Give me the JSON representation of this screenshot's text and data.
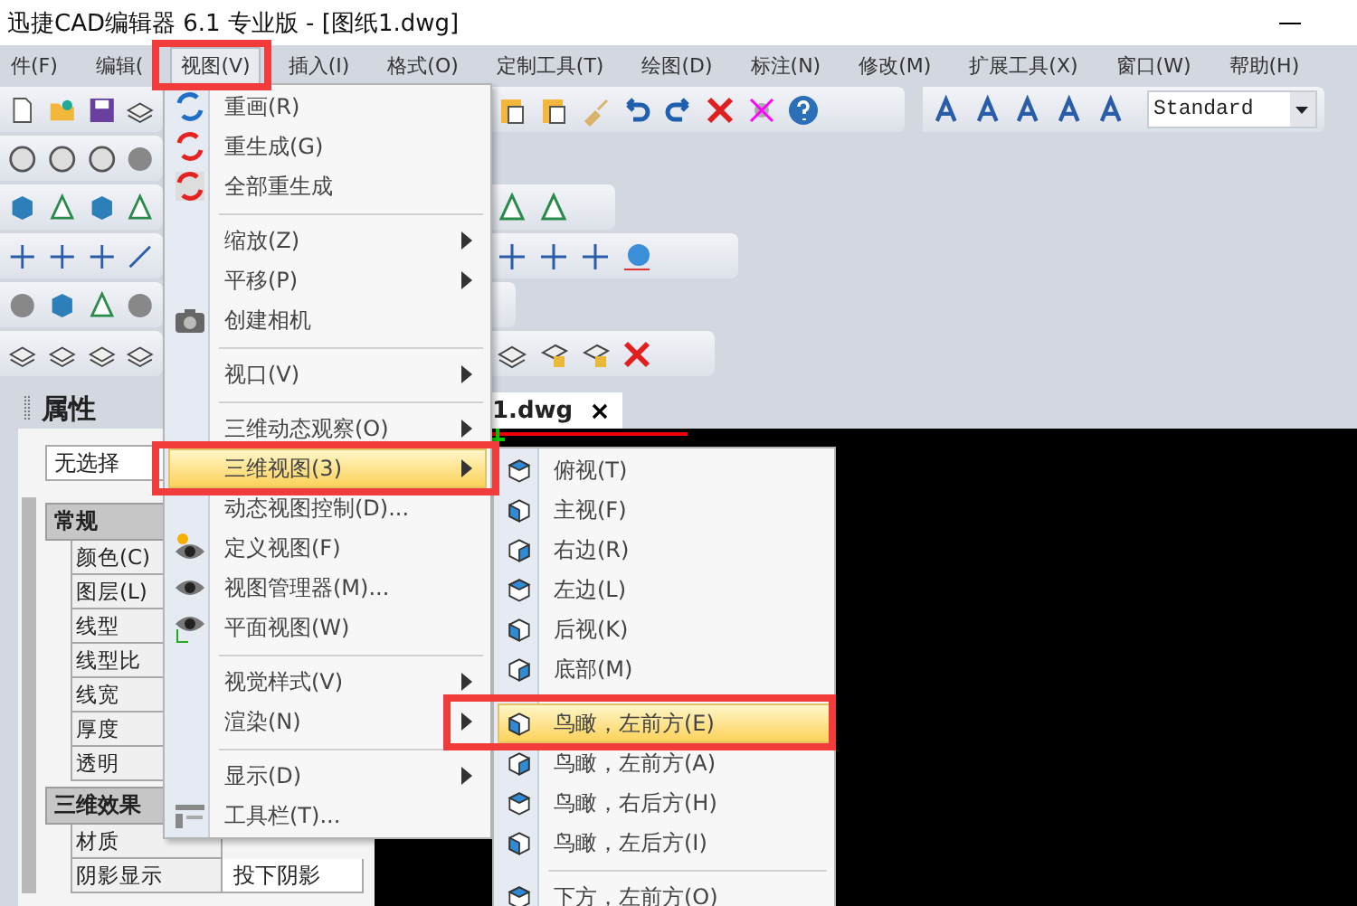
{
  "window": {
    "title": "迅捷CAD编辑器 6.1 专业版  - [图纸1.dwg]"
  },
  "menu_bar": [
    {
      "label": "件(F)",
      "selected": false
    },
    {
      "label": "编辑(",
      "selected": false
    },
    {
      "label": "视图(V)",
      "selected": true
    },
    {
      "label": "插入(I)",
      "selected": false
    },
    {
      "label": "格式(O)",
      "selected": false
    },
    {
      "label": "定制工具(T)",
      "selected": false
    },
    {
      "label": "绘图(D)",
      "selected": false
    },
    {
      "label": "标注(N)",
      "selected": false
    },
    {
      "label": "修改(M)",
      "selected": false
    },
    {
      "label": "扩展工具(X)",
      "selected": false
    },
    {
      "label": "窗口(W)",
      "selected": false
    },
    {
      "label": "帮助(H)",
      "selected": false
    }
  ],
  "toolbar": {
    "text_style": "Standard"
  },
  "properties_panel": {
    "title": "属性",
    "selection": "无选择",
    "sections": [
      {
        "title": "常规",
        "rows": [
          {
            "name": "颜色(C)"
          },
          {
            "name": "图层(L)"
          },
          {
            "name": "线型"
          },
          {
            "name": "线型比"
          },
          {
            "name": "线宽"
          },
          {
            "name": "厚度"
          },
          {
            "name": "透明"
          }
        ]
      },
      {
        "title": "三维效果",
        "rows": [
          {
            "name": "材质"
          },
          {
            "name": "阴影显示",
            "value": "投下阴影"
          }
        ]
      }
    ]
  },
  "document_tab": {
    "label": "1.dwg"
  },
  "view_menu": {
    "items": [
      {
        "kind": "item",
        "label": "重画(R)",
        "submenu": false,
        "selected": false
      },
      {
        "kind": "item",
        "label": "重生成(G)",
        "submenu": false,
        "selected": false
      },
      {
        "kind": "item",
        "label": "全部重生成",
        "submenu": false,
        "selected": false
      },
      {
        "kind": "separator"
      },
      {
        "kind": "item",
        "label": "缩放(Z)",
        "submenu": true,
        "selected": false
      },
      {
        "kind": "item",
        "label": "平移(P)",
        "submenu": true,
        "selected": false
      },
      {
        "kind": "item",
        "label": "创建相机",
        "submenu": false,
        "selected": false
      },
      {
        "kind": "separator"
      },
      {
        "kind": "item",
        "label": "视口(V)",
        "submenu": true,
        "selected": false
      },
      {
        "kind": "separator"
      },
      {
        "kind": "item",
        "label": "三维动态观察(O)",
        "submenu": true,
        "selected": false
      },
      {
        "kind": "item",
        "label": "三维视图(3)",
        "submenu": true,
        "selected": true
      },
      {
        "kind": "item",
        "label": "动态视图控制(D)...",
        "submenu": false,
        "selected": false
      },
      {
        "kind": "item",
        "label": "定义视图(F)",
        "submenu": false,
        "selected": false
      },
      {
        "kind": "item",
        "label": "视图管理器(M)...",
        "submenu": false,
        "selected": false
      },
      {
        "kind": "item",
        "label": "平面视图(W)",
        "submenu": false,
        "selected": false
      },
      {
        "kind": "separator"
      },
      {
        "kind": "item",
        "label": "视觉样式(V)",
        "submenu": true,
        "selected": false
      },
      {
        "kind": "item",
        "label": "渲染(N)",
        "submenu": true,
        "selected": false
      },
      {
        "kind": "separator"
      },
      {
        "kind": "item",
        "label": "显示(D)",
        "submenu": true,
        "selected": false
      },
      {
        "kind": "item",
        "label": "工具栏(T)...",
        "submenu": false,
        "selected": false
      }
    ]
  },
  "view_3d_submenu": {
    "items": [
      {
        "kind": "item",
        "label": "俯视(T)",
        "selected": false
      },
      {
        "kind": "item",
        "label": "主视(F)",
        "selected": false
      },
      {
        "kind": "item",
        "label": "右边(R)",
        "selected": false
      },
      {
        "kind": "item",
        "label": "左边(L)",
        "selected": false
      },
      {
        "kind": "item",
        "label": "后视(K)",
        "selected": false
      },
      {
        "kind": "item",
        "label": "底部(M)",
        "selected": false
      },
      {
        "kind": "separator"
      },
      {
        "kind": "item",
        "label": "鸟瞰，左前方(E)",
        "selected": true
      },
      {
        "kind": "item",
        "label": "鸟瞰，左前方(A)",
        "selected": false
      },
      {
        "kind": "item",
        "label": "鸟瞰，右后方(H)",
        "selected": false
      },
      {
        "kind": "item",
        "label": "鸟瞰，左后方(I)",
        "selected": false
      },
      {
        "kind": "separator"
      },
      {
        "kind": "item",
        "label": "下方，左前方(O)",
        "selected": false
      }
    ]
  }
}
